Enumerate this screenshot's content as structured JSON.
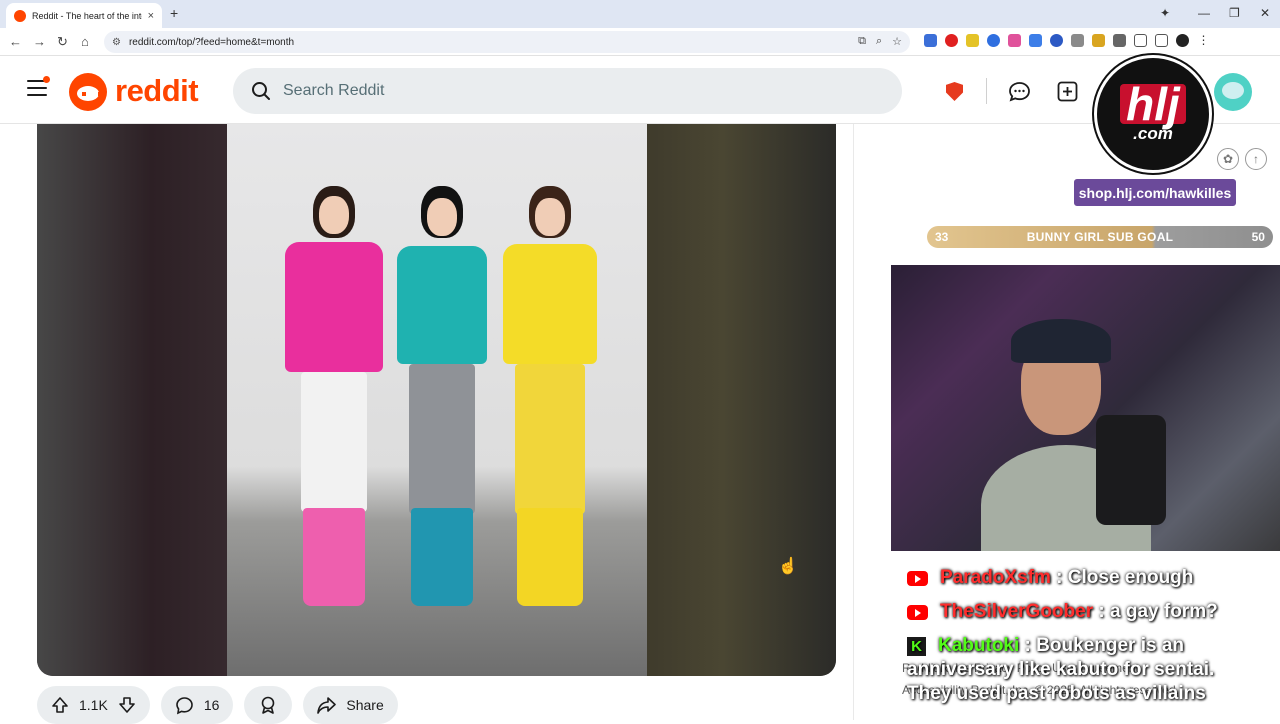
{
  "browser": {
    "tab_title": "Reddit - The heart of the internet",
    "tab_close": "×",
    "new_tab": "+",
    "url": "reddit.com/top/?feed=home&t=month",
    "window_controls": [
      "—",
      "❐",
      "✕"
    ]
  },
  "reddit": {
    "logo_text": "reddit",
    "search_placeholder": "Search Reddit"
  },
  "post": {
    "upvotes": "1.1K",
    "comments": "16",
    "share_label": "Share"
  },
  "overlay": {
    "hlj_logo": "hlj",
    "hlj_sub": ".com",
    "hlj_link": "shop.hlj.com/hawkilles",
    "goal": {
      "current": "33",
      "label": "BUNNY GIRL SUB GOAL",
      "target": "50",
      "progress": 0.66
    },
    "chat": [
      {
        "platform": "youtube",
        "user": "ParadoXsfm",
        "user_color": "#ff2d2d",
        "message": "Close enough"
      },
      {
        "platform": "youtube",
        "user": "TheSilverGoober",
        "user_color": "#ff2d2d",
        "message": "a gay form?"
      },
      {
        "platform": "kick",
        "user": "Kabutoki",
        "user_color": "#53fc18",
        "message": "Boukenger is an"
      },
      {
        "platform": "text",
        "user": "",
        "user_color": "#ffffff",
        "message": "anniversary like kabuto for sentai."
      },
      {
        "platform": "text",
        "user": "",
        "user_color": "#ffffff",
        "message": "They used past robots as villains"
      }
    ],
    "kick_glyph": "K"
  },
  "footer": {
    "line1": "Reddit Rules   Privacy Policy   User Agreement",
    "line2": "Accessibility   Reddit, Inc. © 2025. All rights reserved."
  },
  "colors": {
    "brand": "#ff4500",
    "hlj_red": "#c8102e",
    "hlj_link_bg": "#6b4a9a"
  }
}
